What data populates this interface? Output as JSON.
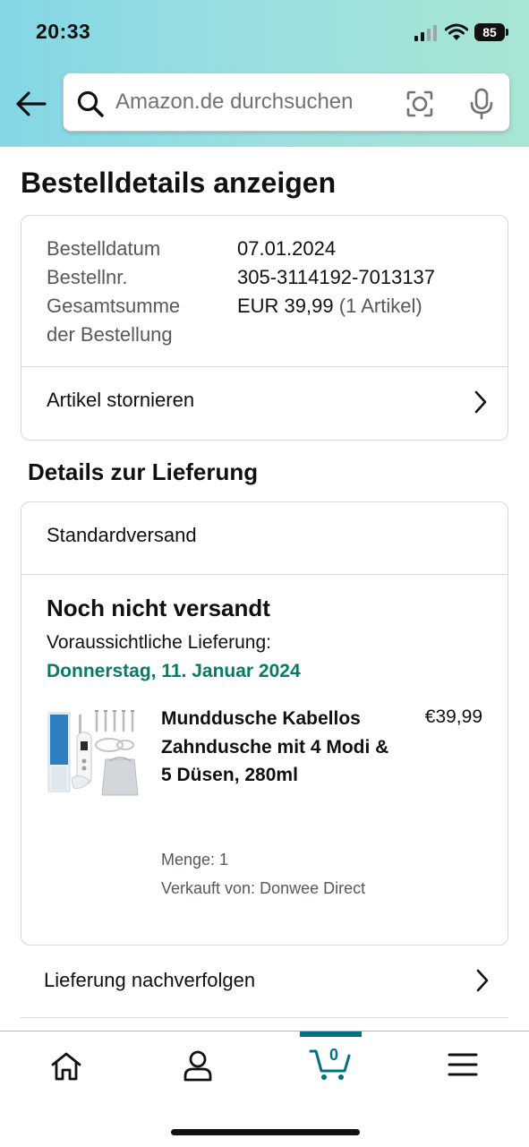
{
  "status_bar": {
    "time": "20:33",
    "battery": "85"
  },
  "search": {
    "placeholder": "Amazon.de durchsuchen",
    "value": ""
  },
  "page": {
    "title": "Bestelldetails anzeigen"
  },
  "order_summary": {
    "order_date_label": "Bestelldatum",
    "order_date": "07.01.2024",
    "order_number_label": "Bestellnr.",
    "order_number": "305-3114192-7013137",
    "total_label_line1": "Gesamtsumme",
    "total_label_line2": "der Bestellung",
    "total_amount": "EUR 39,99",
    "total_items": "(1 Artikel)",
    "cancel_label": "Artikel stornieren"
  },
  "delivery": {
    "section_title": "Details zur Lieferung",
    "shipping_method": "Standardversand",
    "status": "Noch nicht versandt",
    "eta_label": "Voraussichtliche Lieferung:",
    "eta_date": "Donnerstag, 11. Januar 2024",
    "item": {
      "title": "Munddusche Kabellos Zahndusche mit 4 Modi & 5 Düsen, 280ml",
      "price": "€39,99",
      "quantity": "Menge: 1",
      "seller": "Verkauft von: Donwee Direct"
    },
    "track_label": "Lieferung nachverfolgen"
  },
  "tab_bar": {
    "cart_count": "0",
    "active_tab": "cart",
    "accent_color": "#007185"
  },
  "colors": {
    "delivery_date": "#067d62",
    "header_gradient_start": "#83d7e6",
    "header_gradient_end": "#a8e5d3"
  },
  "icons": [
    "back-arrow-icon",
    "search-icon",
    "camera-icon",
    "microphone-icon",
    "chevron-right-icon",
    "home-icon",
    "account-icon",
    "cart-icon",
    "menu-icon",
    "signal-icon",
    "wifi-icon"
  ]
}
